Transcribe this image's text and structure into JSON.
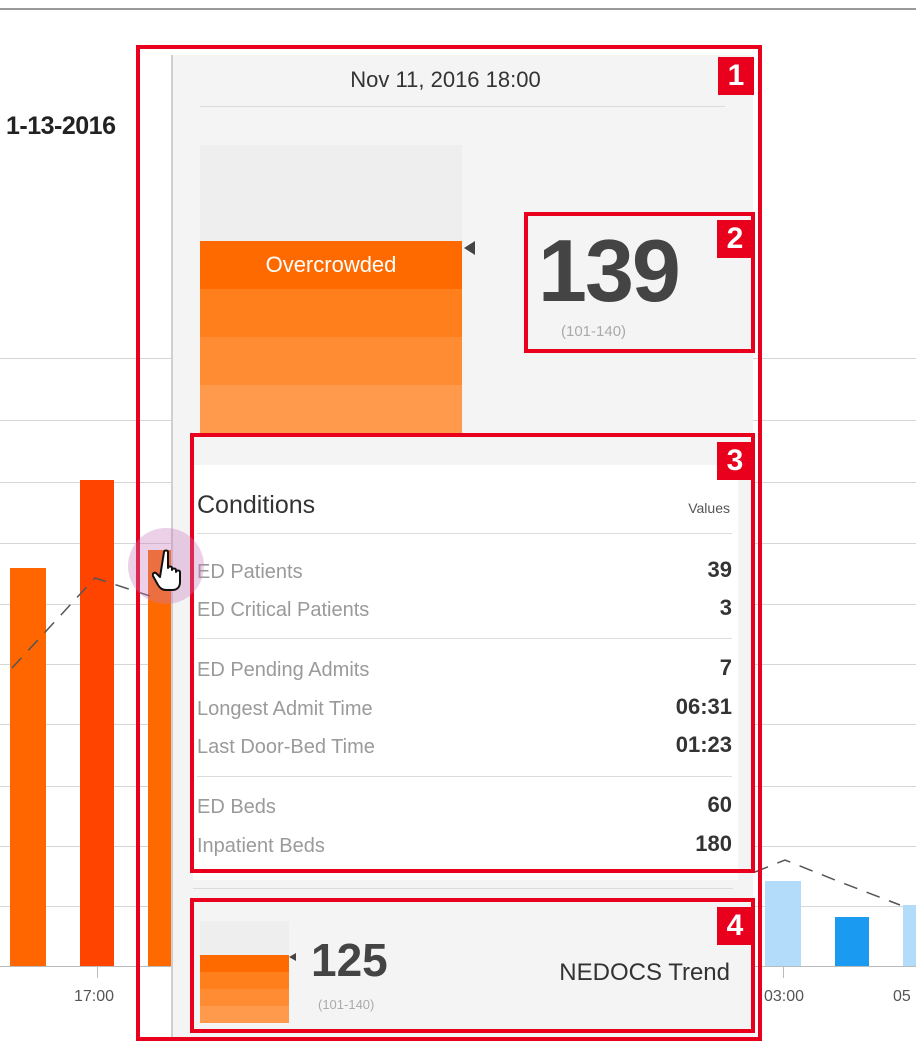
{
  "background_chart": {
    "date_label": "1-13-2016",
    "x_tick_labels": [
      "17:00",
      "03:00",
      "05"
    ],
    "colors": {
      "overcrowded_bar": "#ff6600",
      "severe_bar": "#ff4400",
      "normal_bar_light": "#b3dcfb",
      "normal_bar": "#1a9af0"
    }
  },
  "tooltip": {
    "datetime": "Nov 11, 2016  18:00",
    "status_levels": [
      {
        "label": "",
        "color": "#eeeeee"
      },
      {
        "label": "",
        "color": "#eeeeee"
      },
      {
        "label": "Overcrowded",
        "color": "#ff6a00"
      },
      {
        "label": "",
        "color": "#ff7f1c"
      },
      {
        "label": "",
        "color": "#ff8c33"
      },
      {
        "label": "",
        "color": "#ff9a4d"
      }
    ],
    "current_level": "Overcrowded",
    "score": "139",
    "score_range": "(101-140)",
    "conditions": {
      "title": "Conditions",
      "values_header": "Values",
      "groups": [
        [
          {
            "label": "ED Patients",
            "value": "39"
          },
          {
            "label": "ED Critical Patients",
            "value": "3"
          }
        ],
        [
          {
            "label": "ED Pending Admits",
            "value": "7"
          },
          {
            "label": "Longest Admit Time",
            "value": "06:31"
          },
          {
            "label": "Last Door-Bed Time",
            "value": "01:23"
          }
        ],
        [
          {
            "label": "ED Beds",
            "value": "60"
          },
          {
            "label": "Inpatient Beds",
            "value": "180"
          }
        ]
      ]
    },
    "trend": {
      "score": "125",
      "score_range": "(101-140)",
      "label": "NEDOCS Trend"
    }
  },
  "annotations": {
    "badges": [
      "1",
      "2",
      "3",
      "4"
    ],
    "highlight_color": "#e8001c"
  },
  "cursor": {
    "icon": "hand-pointer-icon"
  }
}
